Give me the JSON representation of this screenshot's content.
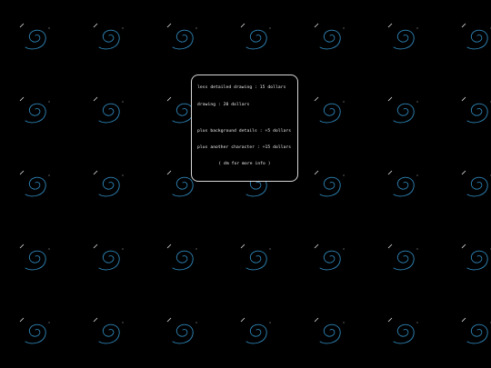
{
  "background_color": "#000000",
  "pattern": {
    "icon": "swirl-doodle-icon",
    "swirl_color": "#2f86b8",
    "accent_color": "#e8e8e8"
  },
  "price_card": {
    "border_color": "#d8d8d8",
    "lines": [
      "less detailed drawing : 15 dollars",
      "drawing : 20 dollars",
      "plus background details : +5 dollars",
      "plus another character : +15 dollars",
      "( dm for more info )"
    ]
  }
}
